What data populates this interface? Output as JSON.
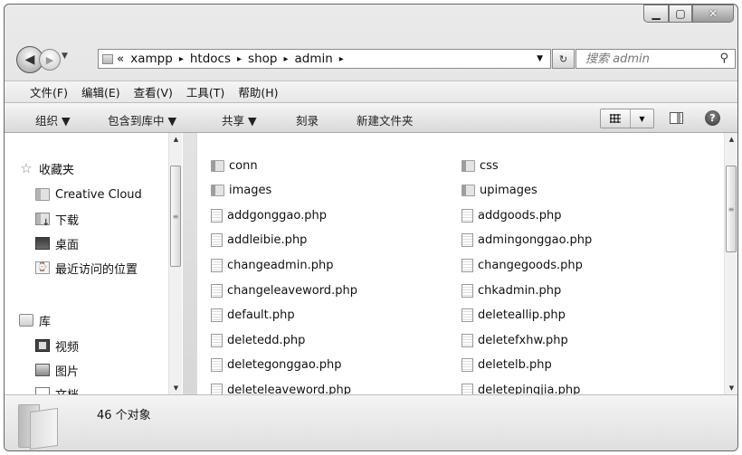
{
  "window": {
    "controls": {
      "minimize": "▁",
      "maximize": "▢",
      "close": "✕"
    }
  },
  "nav": {
    "back_glyph": "◀",
    "forward_glyph": "▶",
    "recent_glyph": "▼",
    "address": {
      "prefix": "«",
      "crumbs": [
        "xampp",
        "htdocs",
        "shop",
        "admin"
      ],
      "separator": "▸",
      "dropdown": "▼"
    },
    "refresh_glyph": "↻",
    "search": {
      "placeholder": "搜索 admin",
      "icon": "search-icon"
    }
  },
  "menubar": {
    "items": [
      "文件(F)",
      "编辑(E)",
      "查看(V)",
      "工具(T)",
      "帮助(H)"
    ]
  },
  "commandbar": {
    "organize": "组织 ▼",
    "include_library": "包含到库中 ▼",
    "share": "共享 ▼",
    "burn": "刻录",
    "new_folder": "新建文件夹",
    "help": "?"
  },
  "sidebar": {
    "favorites": {
      "label": "收藏夹",
      "icon": "star-icon"
    },
    "items": [
      {
        "label": "Creative Cloud",
        "icon": "folder-icon"
      },
      {
        "label": "下载",
        "icon": "downloads-icon"
      },
      {
        "label": "桌面",
        "icon": "desktop-icon"
      },
      {
        "label": "最近访问的位置",
        "icon": "recent-places-icon"
      }
    ],
    "libraries": {
      "label": "库",
      "icon": "library-icon"
    },
    "library_items": [
      {
        "label": "视频",
        "icon": "video-icon"
      },
      {
        "label": "图片",
        "icon": "pictures-icon"
      },
      {
        "label": "文档",
        "icon": "documents-icon"
      }
    ]
  },
  "files": {
    "left": [
      {
        "name": "conn",
        "type": "folder"
      },
      {
        "name": "images",
        "type": "folder"
      },
      {
        "name": "addgonggao.php",
        "type": "php"
      },
      {
        "name": "addleibie.php",
        "type": "php"
      },
      {
        "name": "changeadmin.php",
        "type": "php"
      },
      {
        "name": "changeleaveword.php",
        "type": "php"
      },
      {
        "name": "default.php",
        "type": "php"
      },
      {
        "name": "deletedd.php",
        "type": "php"
      },
      {
        "name": "deletegonggao.php",
        "type": "php"
      },
      {
        "name": "deleteleaveword.php",
        "type": "php"
      }
    ],
    "right": [
      {
        "name": "css",
        "type": "folder"
      },
      {
        "name": "upimages",
        "type": "folder"
      },
      {
        "name": "addgoods.php",
        "type": "php"
      },
      {
        "name": "admingonggao.php",
        "type": "php"
      },
      {
        "name": "changegoods.php",
        "type": "php"
      },
      {
        "name": "chkadmin.php",
        "type": "php"
      },
      {
        "name": "deleteallip.php",
        "type": "php"
      },
      {
        "name": "deletefxhw.php",
        "type": "php"
      },
      {
        "name": "deletelb.php",
        "type": "php"
      },
      {
        "name": "deletepingjia.php",
        "type": "php"
      }
    ]
  },
  "scroll": {
    "up": "▲",
    "down": "▼",
    "grip": "≡"
  },
  "details": {
    "count": "46 个对象"
  }
}
